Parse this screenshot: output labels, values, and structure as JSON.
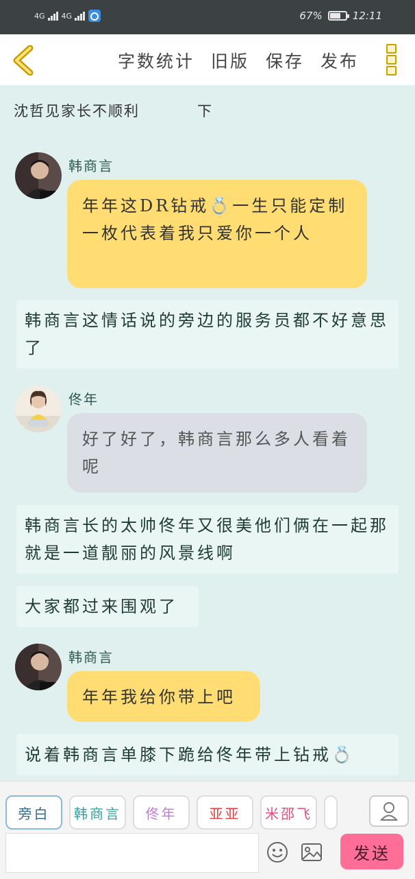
{
  "status_bar": {
    "signal_1": "4G",
    "signal_2": "4G",
    "battery": "67%",
    "battery_level": 0.67,
    "time": "12:11"
  },
  "toolbar": {
    "actions": [
      "字数统计",
      "旧版",
      "保存",
      "发布"
    ]
  },
  "doc": {
    "title": "沈哲见家长不顺利",
    "title_suffix": "下"
  },
  "messages": [
    {
      "speaker": "韩商言",
      "text": "年年这DR钻戒💍一生只能定制一枚代表着我只爱你一个人"
    },
    {
      "narration": "韩商言这情话说的旁边的服务员都不好意思了"
    },
    {
      "speaker": "佟年",
      "text": "好了好了，韩商言那么多人看着呢"
    },
    {
      "narration": "韩商言长的太帅佟年又很美他们俩在一起那就是一道靓丽的风景线啊"
    },
    {
      "narration": "大家都过来围观了"
    },
    {
      "speaker": "韩商言",
      "text": "年年我给你带上吧"
    },
    {
      "narration": "说着韩商言单膝下跪给佟年带上钻戒💍"
    }
  ],
  "characters": [
    {
      "name": "旁白",
      "color": "#3a6a8a"
    },
    {
      "name": "韩商言",
      "color": "#2aa5a0"
    },
    {
      "name": "佟年",
      "color": "#c07ad8"
    },
    {
      "name": "亚亚",
      "color": "#e04040"
    },
    {
      "name": "米邵飞",
      "color": "#e0507a"
    }
  ],
  "composer": {
    "send_label": "发送"
  },
  "colors": {
    "accent_send": "#ff6e96",
    "bubble_main": "#ffdd73",
    "bubble_other": "#dbdee4",
    "page_bg": "#dff0ee"
  }
}
